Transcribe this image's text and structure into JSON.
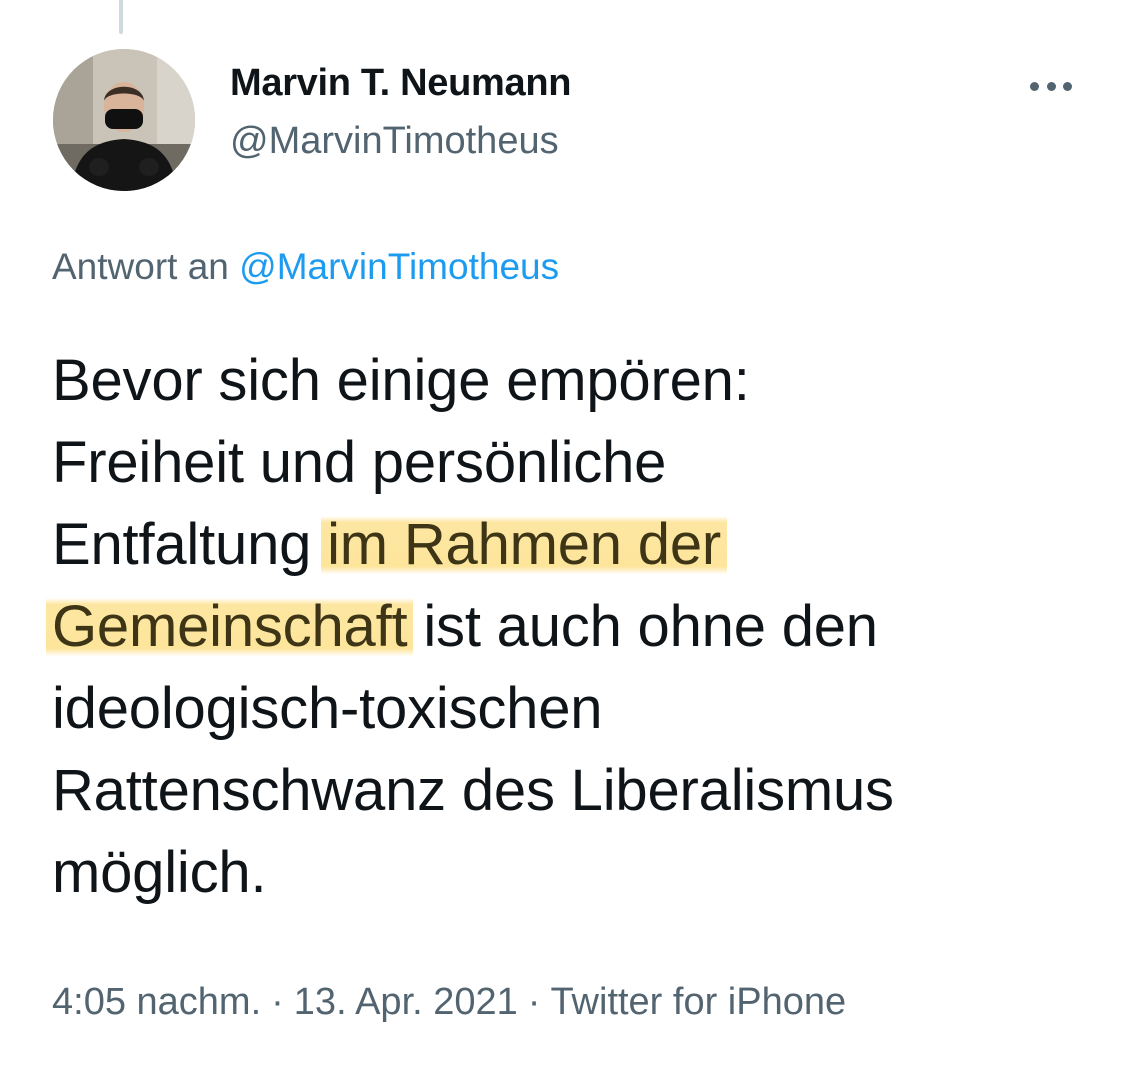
{
  "tweet": {
    "author": {
      "display_name": "Marvin T. Neumann",
      "handle": "@MarvinTimotheus",
      "avatar_icon": "person-avatar-icon"
    },
    "reply_to": {
      "prefix": "Antwort an",
      "mention": "@MarvinTimotheus"
    },
    "text": {
      "line1": "Bevor sich einige empören:",
      "line2": "Freiheit und persönliche",
      "line3_plain": "Entfaltung ",
      "line3_highlight": "im Rahmen der",
      "line4_highlight": "Gemeinschaft",
      "line4_plain": " ist auch ohne den",
      "line5": "ideologisch-toxischen",
      "line6": "Rattenschwanz des Liberalismus",
      "line7": "möglich."
    },
    "meta": {
      "time": "4:05 nachm.",
      "separator": "·",
      "date": "13. Apr. 2021",
      "source": "Twitter for iPhone"
    },
    "more_icon": "more-horizontal-icon"
  },
  "colors": {
    "text_primary": "#0f1419",
    "text_secondary": "#536471",
    "link": "#1d9bf0",
    "highlight": "#fde291",
    "thread_line": "#cfd9de"
  }
}
